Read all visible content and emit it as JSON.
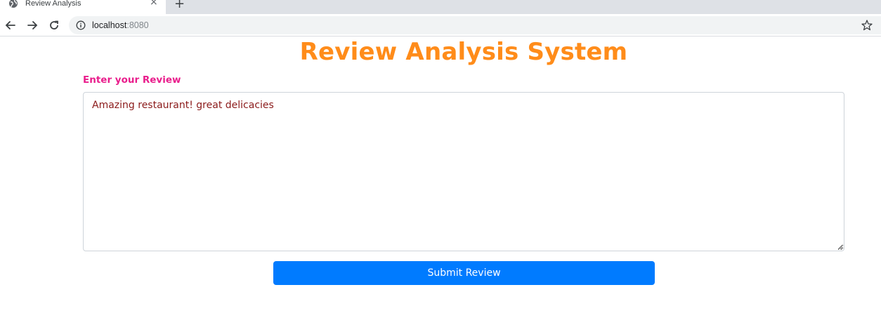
{
  "browser": {
    "tab": {
      "title": "Review Analysis",
      "close": "×",
      "favicon": "globe-icon"
    },
    "new_tab": "+",
    "url": {
      "host": "localhost",
      "port": ":8080"
    },
    "icons": {
      "back": "arrow-left-icon",
      "forward": "arrow-right-icon",
      "reload": "reload-icon",
      "info": "info-icon",
      "bookmark": "star-icon"
    }
  },
  "page": {
    "title": "Review Analysis System",
    "review_label": "Enter your Review",
    "review_value": "Amazing restaurant! great delicacies",
    "submit_label": "Submit Review"
  },
  "colors": {
    "title": "#ff8c1a",
    "label": "#e91e8c",
    "review_text": "#8b1a1a",
    "button": "#007bff"
  }
}
